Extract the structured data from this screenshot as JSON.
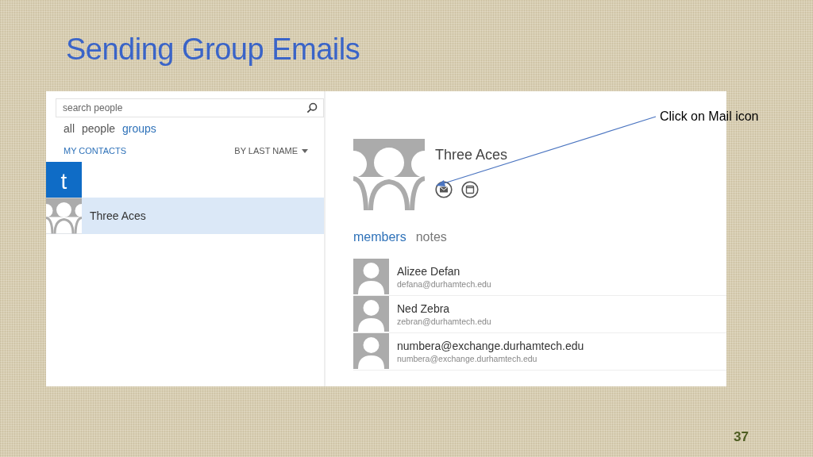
{
  "slide": {
    "title": "Sending Group Emails",
    "callout": "Click on Mail icon",
    "page_number": "37"
  },
  "search": {
    "placeholder": "search people"
  },
  "filters": [
    {
      "label": "all",
      "selected": false
    },
    {
      "label": "people",
      "selected": false
    },
    {
      "label": "groups",
      "selected": true
    }
  ],
  "list_header": {
    "title": "MY CONTACTS",
    "sort": "BY LAST NAME"
  },
  "contacts": [
    {
      "kind": "letter",
      "label": "t"
    },
    {
      "kind": "group",
      "name": "Three Aces",
      "selected": true
    }
  ],
  "group": {
    "name": "Three Aces",
    "tabs": [
      {
        "label": "members",
        "selected": true
      },
      {
        "label": "notes",
        "selected": false
      }
    ],
    "members": [
      {
        "name": "Alizee Defan",
        "email": "defana@durhamtech.edu"
      },
      {
        "name": "Ned Zebra",
        "email": "zebran@durhamtech.edu"
      },
      {
        "name": "numbera@exchange.durhamtech.edu",
        "email": "numbera@exchange.durhamtech.edu"
      }
    ]
  }
}
